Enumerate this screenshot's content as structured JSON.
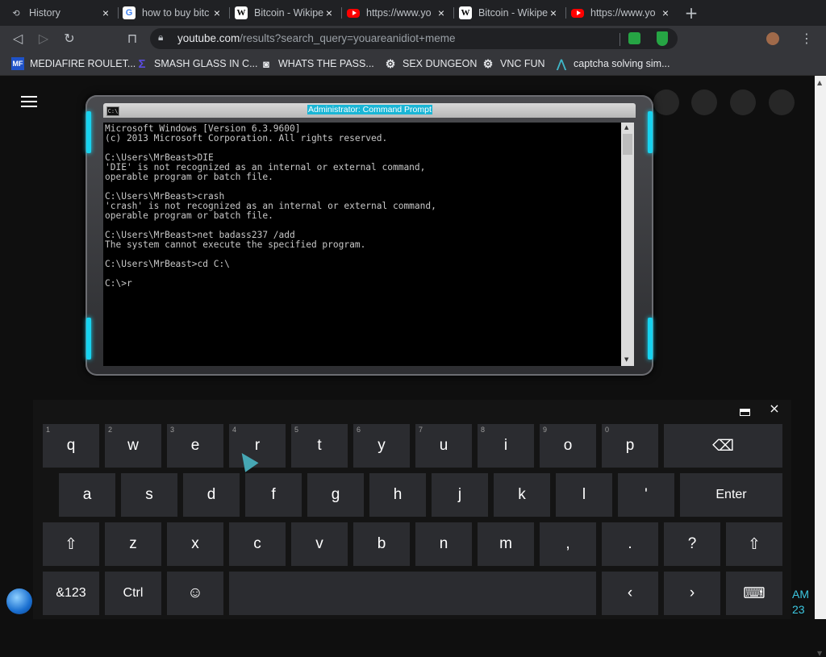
{
  "browser": {
    "tabs": [
      {
        "title": "History",
        "favicon": "history-icon"
      },
      {
        "title": "how to buy bitc",
        "favicon": "google-icon"
      },
      {
        "title": "Bitcoin - Wikipe",
        "favicon": "wikipedia-icon"
      },
      {
        "title": "https://www.yo",
        "favicon": "youtube-icon"
      },
      {
        "title": "Bitcoin - Wikipe",
        "favicon": "wikipedia-icon"
      },
      {
        "title": "https://www.yo",
        "favicon": "youtube-icon"
      }
    ],
    "new_tab_label": "+",
    "close_glyph": "×",
    "address_domain": "youtube.com",
    "address_path": "/results?search_query=youareanidiot+meme",
    "bookmarks": [
      {
        "label": "MEDIAFIRE ROULET...",
        "icon": "mediafire-icon",
        "icon_text": "MF",
        "color": "#1f52c8"
      },
      {
        "label": "SMASH GLASS IN C...",
        "icon": "bracket-icon",
        "icon_text": "Σ",
        "color": "#5b4de0"
      },
      {
        "label": "WHATS THE PASS...",
        "icon": "mask-icon",
        "icon_text": "◙",
        "color": "#e8eaed"
      },
      {
        "label": "SEX DUNGEON",
        "icon": "gear-icon",
        "icon_text": "⚙",
        "color": "#e8eaed"
      },
      {
        "label": "VNC FUN",
        "icon": "gear-icon",
        "icon_text": "⚙",
        "color": "#e8eaed"
      },
      {
        "label": "captcha solving sim...",
        "icon": "logo-icon",
        "icon_text": "⋀",
        "color": "#3fb6c7"
      }
    ]
  },
  "cmd": {
    "window_title": "Administrator: Command Prompt",
    "icon_text": "C:\\",
    "lines": [
      "Microsoft Windows [Version 6.3.9600]",
      "(c) 2013 Microsoft Corporation. All rights reserved.",
      "",
      "C:\\Users\\MrBeast>DIE",
      "'DIE' is not recognized as an internal or external command,",
      "operable program or batch file.",
      "",
      "C:\\Users\\MrBeast>crash",
      "'crash' is not recognized as an internal or external command,",
      "operable program or batch file.",
      "",
      "C:\\Users\\MrBeast>net badass237 /add",
      "The system cannot execute the specified program.",
      "",
      "C:\\Users\\MrBeast>cd C:\\",
      "",
      "C:\\>r"
    ]
  },
  "keyboard": {
    "rows": [
      [
        {
          "label": "q",
          "num": "1",
          "name": "key-q"
        },
        {
          "label": "w",
          "num": "2",
          "name": "key-w"
        },
        {
          "label": "e",
          "num": "3",
          "name": "key-e"
        },
        {
          "label": "r",
          "num": "4",
          "name": "key-r"
        },
        {
          "label": "t",
          "num": "5",
          "name": "key-t"
        },
        {
          "label": "y",
          "num": "6",
          "name": "key-y"
        },
        {
          "label": "u",
          "num": "7",
          "name": "key-u"
        },
        {
          "label": "i",
          "num": "8",
          "name": "key-i"
        },
        {
          "label": "o",
          "num": "9",
          "name": "key-o"
        },
        {
          "label": "p",
          "num": "0",
          "name": "key-p"
        },
        {
          "label": "⌫",
          "num": "",
          "name": "backspace-key",
          "wide": true
        }
      ],
      [
        {
          "label": "a",
          "num": "",
          "name": "key-a"
        },
        {
          "label": "s",
          "num": "",
          "name": "key-s"
        },
        {
          "label": "d",
          "num": "",
          "name": "key-d"
        },
        {
          "label": "f",
          "num": "",
          "name": "key-f"
        },
        {
          "label": "g",
          "num": "",
          "name": "key-g"
        },
        {
          "label": "h",
          "num": "",
          "name": "key-h"
        },
        {
          "label": "j",
          "num": "",
          "name": "key-j"
        },
        {
          "label": "k",
          "num": "",
          "name": "key-k"
        },
        {
          "label": "l",
          "num": "",
          "name": "key-l"
        },
        {
          "label": "'",
          "num": "",
          "name": "key-apostrophe"
        },
        {
          "label": "Enter",
          "num": "",
          "name": "enter-key",
          "wide": true
        }
      ],
      [
        {
          "label": "⇧",
          "num": "",
          "name": "shift-left-key"
        },
        {
          "label": "z",
          "num": "",
          "name": "key-z"
        },
        {
          "label": "x",
          "num": "",
          "name": "key-x"
        },
        {
          "label": "c",
          "num": "",
          "name": "key-c"
        },
        {
          "label": "v",
          "num": "",
          "name": "key-v"
        },
        {
          "label": "b",
          "num": "",
          "name": "key-b"
        },
        {
          "label": "n",
          "num": "",
          "name": "key-n"
        },
        {
          "label": "m",
          "num": "",
          "name": "key-m"
        },
        {
          "label": ",",
          "num": "",
          "name": "key-comma"
        },
        {
          "label": ".",
          "num": "",
          "name": "key-period"
        },
        {
          "label": "?",
          "num": "",
          "name": "key-question"
        },
        {
          "label": "⇧",
          "num": "",
          "name": "shift-right-key"
        }
      ],
      [
        {
          "label": "&123",
          "num": "",
          "name": "symbols-key"
        },
        {
          "label": "Ctrl",
          "num": "",
          "name": "ctrl-key"
        },
        {
          "label": "☺",
          "num": "",
          "name": "emoji-key"
        },
        {
          "label": "",
          "num": "",
          "name": "space-key"
        },
        {
          "label": "‹",
          "num": "",
          "name": "left-arrow-key"
        },
        {
          "label": "›",
          "num": "",
          "name": "right-arrow-key"
        },
        {
          "label": "⌨",
          "num": "",
          "name": "keyboard-layout-key"
        }
      ]
    ]
  },
  "taskbar": {
    "clock_time": "AM",
    "clock_date": "23"
  }
}
